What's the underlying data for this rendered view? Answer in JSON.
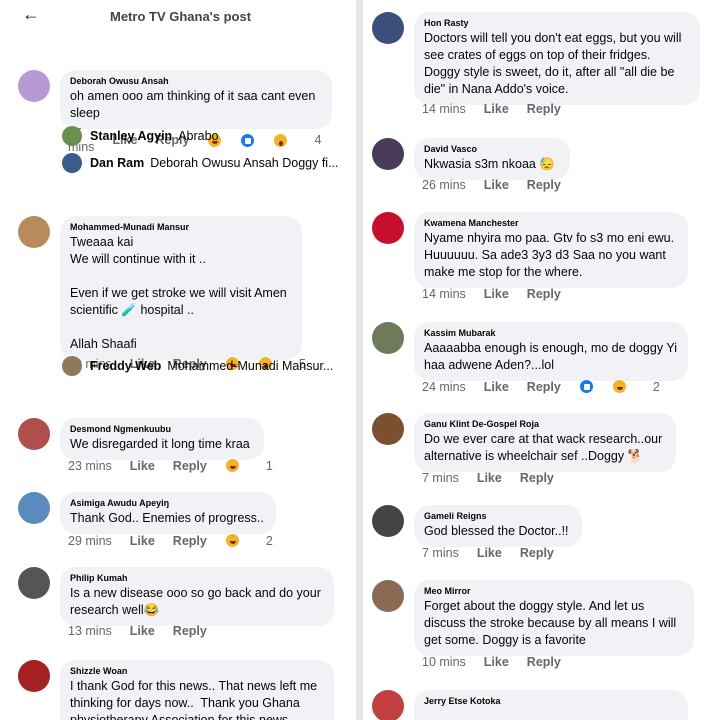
{
  "header": {
    "title": "Metro TV Ghana's post",
    "back": "←"
  },
  "left": [
    {
      "name": "Deborah Owusu Ansah",
      "text": "oh amen ooo am thinking of it saa cant even sleep",
      "time": "25 mins",
      "like": "Like",
      "reply": "Reply",
      "reactions": [
        "haha",
        "likei",
        "wow"
      ],
      "count": "4",
      "color": "#b79ad4"
    },
    {
      "name": "Mohammed-Munadi Mansur",
      "text": "Tweaaa kai\nWe will continue with it ..\n\nEven if we get stroke we will visit Amen scientific 🧪 hospital ..\n\nAllah Shaafi",
      "time": "29 mins",
      "like": "Like",
      "reply": "Reply",
      "reactions": [
        "haha",
        "wow"
      ],
      "count": "5",
      "color": "#b88a5c"
    },
    {
      "name": "Desmond Ngmenkuubu",
      "text": "We disregarded it long time kraa",
      "time": "23 mins",
      "like": "Like",
      "reply": "Reply",
      "reactions": [
        "haha"
      ],
      "count": "1",
      "color": "#b04d4d"
    },
    {
      "name": "Asimiga Awudu Apeyiŋ",
      "text": "Thank God.. Enemies of progress..",
      "time": "29 mins",
      "like": "Like",
      "reply": "Reply",
      "reactions": [
        "haha"
      ],
      "count": "2",
      "color": "#5a8bbf"
    },
    {
      "name": "Philip Kumah",
      "text": "Is a new disease ooo so go back and do your research well😂",
      "time": "13 mins",
      "like": "Like",
      "reply": "Reply",
      "reactions": [],
      "count": "",
      "color": "#555555"
    },
    {
      "name": "Shizzle Woan",
      "text": "I thank God for this news.. That news left me thinking for days now..  Thank you Ghana physiotherapy Association for this news..",
      "time": "",
      "like": "",
      "reply": "",
      "reactions": [],
      "count": "",
      "color": "#a52020"
    }
  ],
  "replies": [
    {
      "name": "Stanley Agyin",
      "text": "Abrabo",
      "color": "#6b8f4e"
    },
    {
      "name": "Dan Ram",
      "text": "Deborah Owusu Ansah Doggy fi...",
      "color": "#3b5b8c"
    },
    {
      "name": "Freddy Web",
      "text": "Mohammed-Munadi Mansur...",
      "color": "#8c7a5a"
    }
  ],
  "right": [
    {
      "name": "Hon Rasty",
      "text": "Doctors will tell you don't eat eggs, but you will see crates of eggs on top of their fridges. Doggy style is sweet, do it, after all \"all die be die\" in Nana Addo's voice.",
      "time": "14 mins",
      "like": "Like",
      "reply": "Reply",
      "reactions": [],
      "count": "",
      "color": "#3a4f7a"
    },
    {
      "name": "David Vasco",
      "text": "Nkwasia s3m nkoaa 😓",
      "time": "26 mins",
      "like": "Like",
      "reply": "Reply",
      "reactions": [],
      "count": "",
      "color": "#4a3a5a"
    },
    {
      "name": "Kwamena Manchester",
      "text": "Nyame nhyira mo paa. Gtv fo s3 mo eni ewu. Huuuuuu. Sa ade3 3y3 d3 Saa no you want make me stop for the where.",
      "time": "14 mins",
      "like": "Like",
      "reply": "Reply",
      "reactions": [],
      "count": "",
      "color": "#c8102e"
    },
    {
      "name": "Kassim Mubarak",
      "text": "Aaaaabba enough is enough, mo de doggy Yi haa adwene Aden?...lol",
      "time": "24 mins",
      "like": "Like",
      "reply": "Reply",
      "reactions": [
        "likei",
        "haha"
      ],
      "count": "2",
      "color": "#6f7a5a"
    },
    {
      "name": "Ganu Klint De-Gospel Roja",
      "text": "Do we ever care at that wack research..our alternative is wheelchair sef ..Doggy 🐕",
      "time": "7 mins",
      "like": "Like",
      "reply": "Reply",
      "reactions": [],
      "count": "",
      "color": "#7a5030"
    },
    {
      "name": "Gameli Reigns",
      "text": "God blessed the Doctor..!!",
      "time": "7 mins",
      "like": "Like",
      "reply": "Reply",
      "reactions": [],
      "count": "",
      "color": "#444444"
    },
    {
      "name": "Meo Mirror",
      "text": "Forget about the doggy style. And let us discuss the stroke because by all means I will get some. Doggy is a favorite",
      "time": "10 mins",
      "like": "Like",
      "reply": "Reply",
      "reactions": [],
      "count": "",
      "color": "#8a6a50"
    },
    {
      "name": "Jerry Etse Kotoka",
      "text": "",
      "time": "",
      "like": "",
      "reply": "",
      "reactions": [],
      "count": "",
      "color": "#c04040"
    }
  ]
}
